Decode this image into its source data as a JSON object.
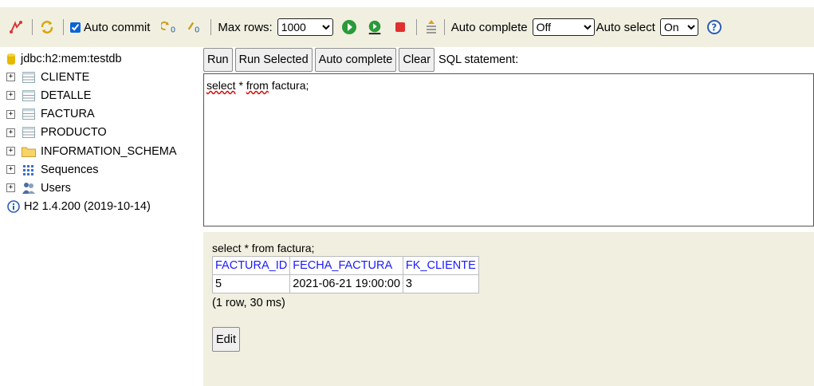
{
  "toolbar": {
    "auto_commit_label": "Auto commit",
    "max_rows_label": "Max rows:",
    "max_rows_value": "1000",
    "auto_complete_label": "Auto complete",
    "auto_complete_value": "Off",
    "auto_select_label": "Auto select",
    "auto_select_value": "On"
  },
  "tree": {
    "connection": "jdbc:h2:mem:testdb",
    "items": [
      {
        "label": "CLIENTE",
        "icon": "table-icon"
      },
      {
        "label": "DETALLE",
        "icon": "table-icon"
      },
      {
        "label": "FACTURA",
        "icon": "table-icon"
      },
      {
        "label": "PRODUCTO",
        "icon": "table-icon"
      },
      {
        "label": "INFORMATION_SCHEMA",
        "icon": "folder-icon"
      },
      {
        "label": "Sequences",
        "icon": "sequences-icon"
      },
      {
        "label": "Users",
        "icon": "users-icon"
      }
    ],
    "version": "H2 1.4.200 (2019-10-14)"
  },
  "sql": {
    "buttons": {
      "run": "Run",
      "run_selected": "Run Selected",
      "auto_complete": "Auto complete",
      "clear": "Clear"
    },
    "label": "SQL statement:",
    "text_parts": [
      "select",
      " * ",
      "from",
      " factura;"
    ]
  },
  "results": {
    "statement": "select * from factura;",
    "columns": [
      "FACTURA_ID",
      "FECHA_FACTURA",
      "FK_CLIENTE"
    ],
    "rows": [
      [
        "5",
        "2021-06-21 19:00:00",
        "3"
      ]
    ],
    "summary": "(1 row, 30 ms)",
    "edit_label": "Edit"
  }
}
